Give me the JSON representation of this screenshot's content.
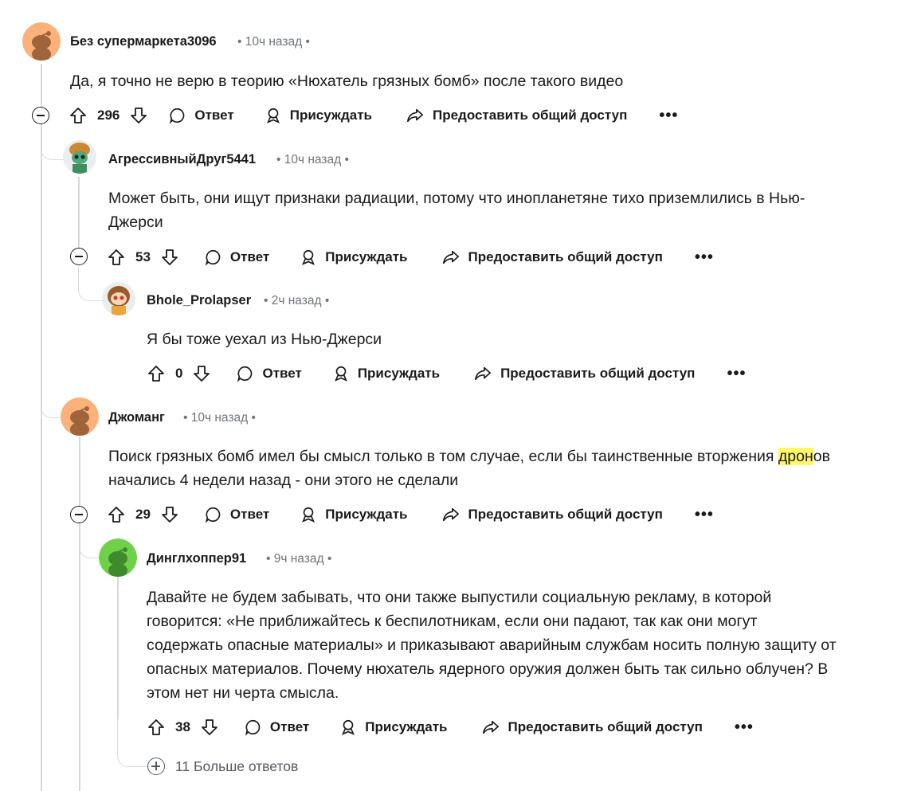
{
  "comments": [
    {
      "username": "Без супермаркета3096",
      "time": "• 10ч назад •",
      "body": "Да, я точно не верю в теорию «Нюхатель грязных бомб» после такого видео",
      "votes": "296",
      "avatar_color": "#fbb17a"
    },
    {
      "username": "АгрессивныйДруг5441",
      "time": "• 10ч назад •",
      "body_line1": "Может быть, они ищут признаки радиации, потому что инопланетяне тихо приземлились в Нью-",
      "body_line2": "Джерси",
      "votes": "53"
    },
    {
      "username": "Bhole_Prolapser",
      "time": "• 2ч назад •",
      "body": "Я бы тоже уехал из Нью-Джерси",
      "votes": "0"
    },
    {
      "username": "Джоманг",
      "time": "• 10ч назад •",
      "body_line1_pre": "Поиск грязных бомб имел бы смысл только в том случае, если бы таинственные вторжения ",
      "body_line1_hl": "дрон",
      "body_line1_post": "ов",
      "body_line2": "начались 4 недели назад - они этого не сделали",
      "votes": "29",
      "avatar_color": "#fbb17a"
    },
    {
      "username": "Динглхоппер91",
      "time": "• 9ч назад •",
      "body_lines": [
        "Давайте не будем забывать, что они также выпустили социальную рекламу, в которой",
        "говорится: «Не приближайтесь к беспилотникам, если они падают, так как они могут",
        "содержать опасные материалы» и приказывают аварийным службам носить полную защиту от",
        "опасных материалов. Почему нюхатель ядерного оружия должен быть так сильно облучен? В",
        "этом нет ни черта смысла."
      ],
      "votes": "38",
      "avatar_color": "#6fd14a"
    }
  ],
  "actions": {
    "reply": "Ответ",
    "award": "Присуждать",
    "share": "Предоставить общий доступ",
    "more": "•••"
  },
  "more_replies": "11 Больше ответов",
  "highlight_color": "#fff76a"
}
